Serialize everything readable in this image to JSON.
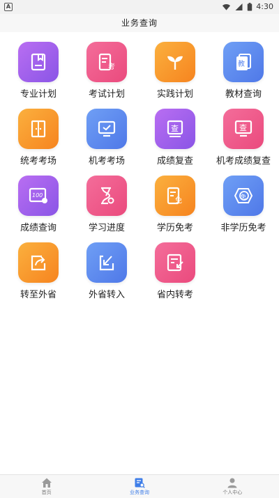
{
  "status_bar": {
    "left_badge": "A",
    "time": "4:30"
  },
  "header": {
    "title": "业务查询"
  },
  "tiles": [
    {
      "label": "专业计划",
      "color": "purple",
      "icon": "book-bookmark-icon"
    },
    {
      "label": "考试计划",
      "color": "pink",
      "icon": "exam-doc-icon"
    },
    {
      "label": "实践计划",
      "color": "orange",
      "icon": "sprout-icon"
    },
    {
      "label": "教材查询",
      "color": "blue",
      "icon": "textbook-icon"
    },
    {
      "label": "统考考场",
      "color": "orange",
      "icon": "door-icon"
    },
    {
      "label": "机考考场",
      "color": "blue",
      "icon": "monitor-check-icon"
    },
    {
      "label": "成绩复查",
      "color": "purple",
      "icon": "review-stamp-icon"
    },
    {
      "label": "机考成绩复查",
      "color": "pink",
      "icon": "monitor-review-icon"
    },
    {
      "label": "成绩查询",
      "color": "purple",
      "icon": "score-100-icon"
    },
    {
      "label": "学习进度",
      "color": "pink",
      "icon": "hourglass-icon"
    },
    {
      "label": "学历免考",
      "color": "orange",
      "icon": "exempt-doc-icon"
    },
    {
      "label": "非学历免考",
      "color": "blue",
      "icon": "exempt-badge-icon"
    },
    {
      "label": "转至外省",
      "color": "orange",
      "icon": "share-out-icon"
    },
    {
      "label": "外省转入",
      "color": "blue",
      "icon": "transfer-in-icon"
    },
    {
      "label": "省内转考",
      "color": "pink",
      "icon": "doc-transfer-icon"
    }
  ],
  "bottom_nav": [
    {
      "label": "首页",
      "icon": "home-icon",
      "active": false
    },
    {
      "label": "业务查询",
      "icon": "business-search-icon",
      "active": true
    },
    {
      "label": "个人中心",
      "icon": "person-icon",
      "active": false
    }
  ],
  "colors": {
    "purple": "#9b5ff0",
    "pink": "#ef5a88",
    "orange": "#f8952c",
    "blue": "#5b86ee",
    "active_nav": "#3f7ee8"
  }
}
